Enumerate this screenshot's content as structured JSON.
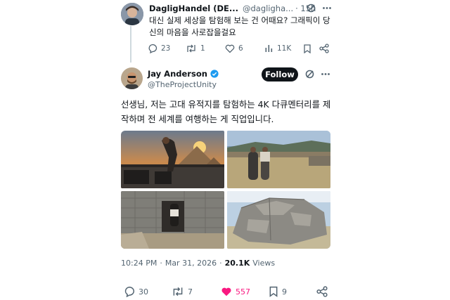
{
  "reply": {
    "author_name": "DagligHandel (DE...",
    "handle": "@dagligha...",
    "time": "· 15h",
    "text": "대신 실제 세상을 탐험해 보는 건 어때요? 그래픽이 당신의 마음을 사로잡을걸요",
    "replies": "23",
    "reposts": "1",
    "likes": "6",
    "views": "11K"
  },
  "main": {
    "author_name": "Jay Anderson",
    "handle": "@TheProjectUnity",
    "follow_label": "Follow",
    "text": "선생님, 저는 고대 유적지를 탐험하는 4K 다큐멘터리를 제작하며 전 세계를 여행하는 게 직업입니다.",
    "time": "10:24 PM",
    "date": "Mar 31, 2026",
    "view_count": "20.1K",
    "views_label": "Views",
    "replies": "30",
    "reposts": "7",
    "likes": "557",
    "bookmarks": "9"
  },
  "colors": {
    "verified": "#1d9bf0",
    "like_active": "#f91880",
    "muted_text": "#536471"
  },
  "icons": [
    "more-icon",
    "grok-icon",
    "reply-icon",
    "repost-icon",
    "like-icon",
    "views-icon",
    "bookmark-icon",
    "share-icon",
    "verified-badge-icon"
  ]
}
